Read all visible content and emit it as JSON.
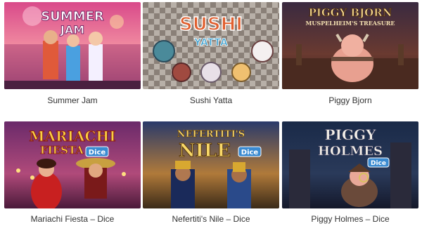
{
  "games": [
    {
      "id": "summer-jam",
      "caption": "Summer Jam",
      "art_title_1": "SUMMER",
      "art_title_2": "JAM"
    },
    {
      "id": "sushi-yatta",
      "caption": "Sushi Yatta",
      "art_title_1": "SUSHI",
      "art_title_2": "YATTA"
    },
    {
      "id": "piggy-bjorn",
      "caption": "Piggy Bjorn",
      "art_title_1": "PIGGY BJORN",
      "art_title_2": "MUSPELHEIM'S TREASURE"
    },
    {
      "id": "mariachi-fiesta-dice",
      "caption": "Mariachi Fiesta – Dice",
      "art_title_1": "MARIACHI",
      "art_title_2": "FIESTA",
      "art_badge": "Dice"
    },
    {
      "id": "nefertitis-nile-dice",
      "caption": "Nefertiti's Nile – Dice",
      "art_title_1": "NEFERTITI'S",
      "art_title_2": "NILE",
      "art_badge": "Dice"
    },
    {
      "id": "piggy-holmes-dice",
      "caption": "Piggy Holmes – Dice",
      "art_title_1": "PIGGY",
      "art_title_2": "HOLMES",
      "art_badge": "Dice"
    }
  ]
}
